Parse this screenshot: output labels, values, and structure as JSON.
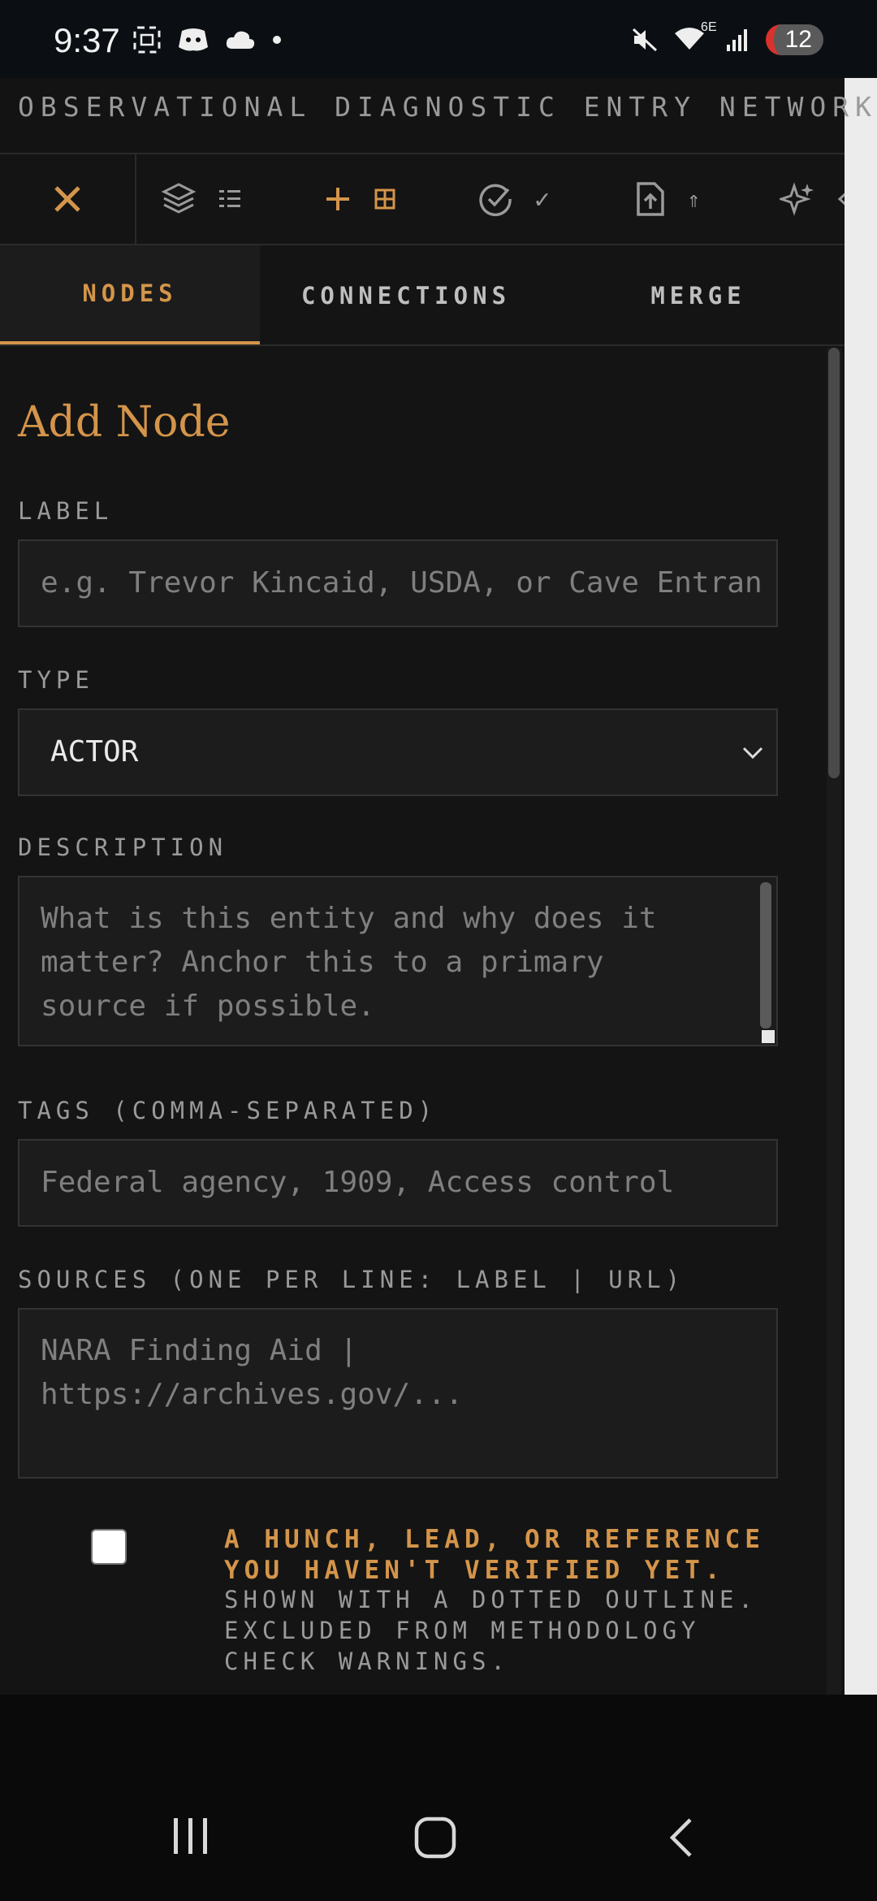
{
  "status_bar": {
    "time": "9:37",
    "network": "6E",
    "notification_count": "12"
  },
  "app": {
    "title": "OBSERVATIONAL DIAGNOSTIC ENTRY NETWORK"
  },
  "toolbar": {
    "check_glyph": "✓",
    "export_glyph": "⇑"
  },
  "tabs": [
    {
      "label": "NODES",
      "active": true
    },
    {
      "label": "CONNECTIONS",
      "active": false
    },
    {
      "label": "MERGE",
      "active": false
    }
  ],
  "form": {
    "title": "Add Node",
    "label": {
      "label": "LABEL",
      "placeholder": "e.g. Trevor Kincaid, USDA, or Cave Entran"
    },
    "type": {
      "label": "TYPE",
      "value": "ACTOR"
    },
    "description": {
      "label": "DESCRIPTION",
      "placeholder": "What is this entity and why does it matter? Anchor this to a primary source if possible."
    },
    "tags": {
      "label": "TAGS (COMMA-SEPARATED)",
      "placeholder": "Federal agency, 1909, Access control"
    },
    "sources": {
      "label": "SOURCES (ONE PER LINE: LABEL | URL)",
      "placeholder": "NARA Finding Aid | https://archives.gov/..."
    },
    "unverified": {
      "checked": false,
      "title": "A HUNCH, LEAD, OR REFERENCE YOU HAVEN'T VERIFIED YET.",
      "description": "SHOWN WITH A DOTTED OUTLINE. EXCLUDED FROM METHODOLOGY CHECK WARNINGS."
    }
  },
  "colors": {
    "accent": "#d4954a",
    "background": "#141414",
    "field_bg": "#1c1c1c"
  }
}
